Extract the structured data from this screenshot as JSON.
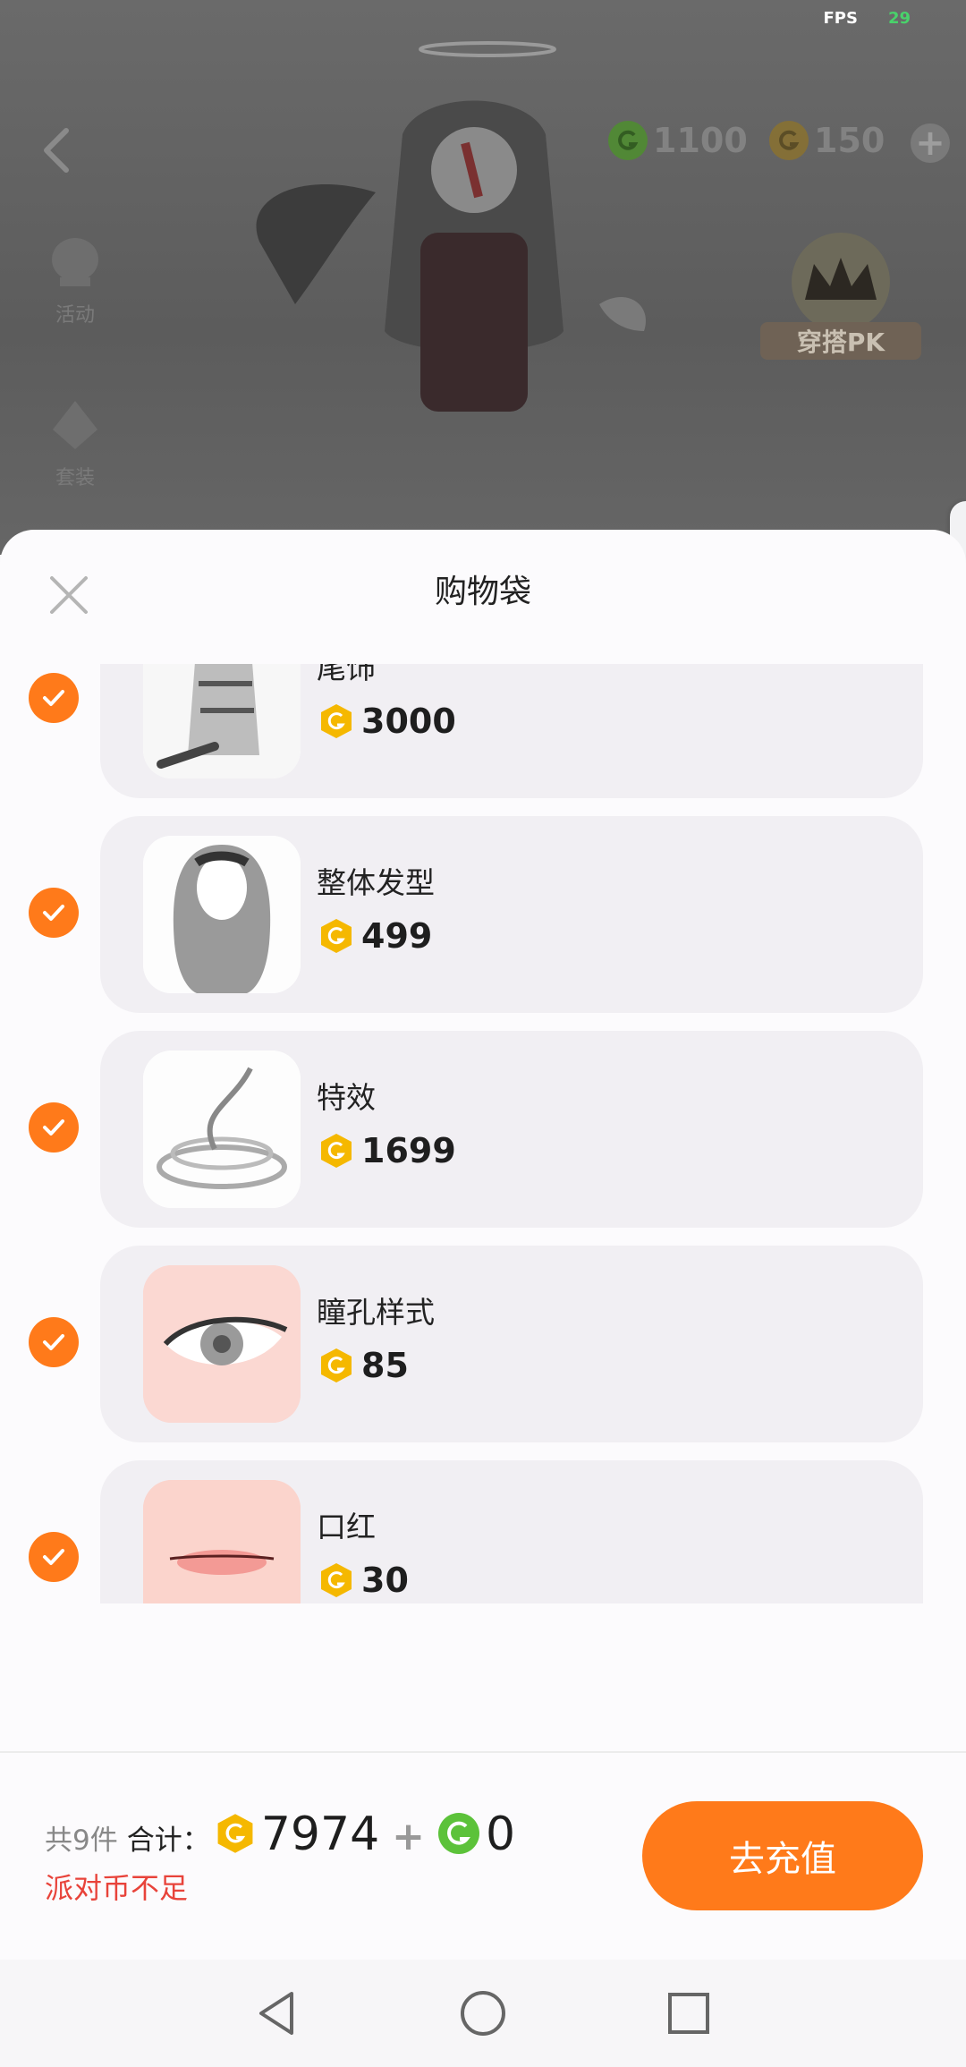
{
  "status": {
    "fps_label": "FPS",
    "fps_value": "29"
  },
  "top_bar": {
    "green_currency": "1100",
    "gold_currency": "150",
    "add_symbol": "+",
    "side_labels": [
      "活动",
      "套装"
    ],
    "pk_label": "穿搭PK"
  },
  "sheet": {
    "title": "购物袋",
    "items": [
      {
        "name": "尾饰",
        "price": "3000",
        "thumb": "tiger-tail-thumb"
      },
      {
        "name": "整体发型",
        "price": "499",
        "thumb": "hairstyle-thumb"
      },
      {
        "name": "特效",
        "price": "1699",
        "thumb": "effect-thumb"
      },
      {
        "name": "瞳孔样式",
        "price": "85",
        "thumb": "eye-thumb"
      },
      {
        "name": "口红",
        "price": "30",
        "thumb": "lips-thumb"
      }
    ]
  },
  "footer": {
    "count_text": "共9件",
    "total_label": "合计：",
    "gold_total": "7974",
    "plus": "+",
    "green_total": "0",
    "warning": "派对币不足",
    "recharge_label": "去充值"
  },
  "colors": {
    "accent": "#ff7a1a",
    "warning": "#e8433a",
    "gold": "#f5b800",
    "green": "#5cc23a"
  }
}
